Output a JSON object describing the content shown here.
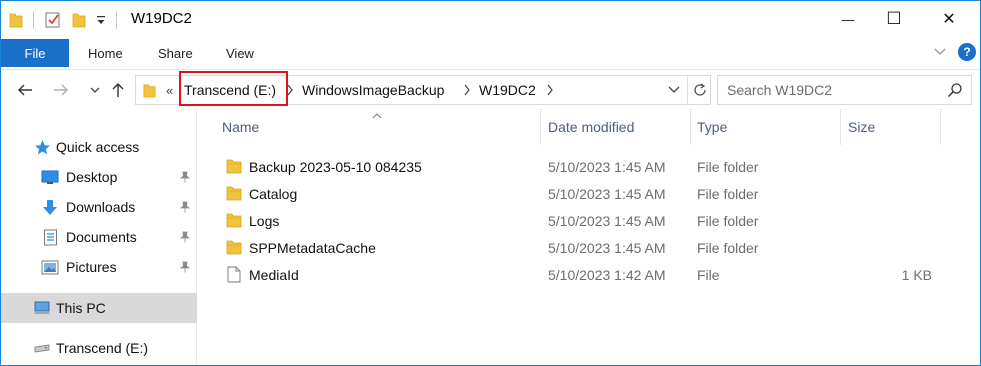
{
  "window": {
    "title": "W19DC2",
    "minimize_glyph": "—",
    "maximize_glyph": "☐",
    "close_glyph": "✕"
  },
  "ribbon": {
    "tabs": [
      "File",
      "Home",
      "Share",
      "View"
    ],
    "help_glyph": "?",
    "accent_color": "#1a6fc9"
  },
  "address": {
    "overflow_glyph": "«",
    "crumbs": [
      "Transcend (E:)",
      "WindowsImageBackup",
      "W19DC2"
    ],
    "highlight_color": "#e0121b"
  },
  "search": {
    "placeholder": "Search W19DC2"
  },
  "sidebar": {
    "items": [
      {
        "label": "Quick access",
        "icon": "star-icon"
      },
      {
        "label": "Desktop",
        "icon": "desktop-icon",
        "pinned": true
      },
      {
        "label": "Downloads",
        "icon": "download-icon",
        "pinned": true
      },
      {
        "label": "Documents",
        "icon": "documents-icon",
        "pinned": true
      },
      {
        "label": "Pictures",
        "icon": "pictures-icon",
        "pinned": true
      },
      {
        "label": "This PC",
        "icon": "computer-icon"
      },
      {
        "label": "Transcend (E:)",
        "icon": "drive-icon"
      }
    ]
  },
  "columns": [
    "Name",
    "Date modified",
    "Type",
    "Size"
  ],
  "files": [
    {
      "name": "Backup 2023-05-10 084235",
      "date": "5/10/2023 1:45 AM",
      "type": "File folder",
      "size": "",
      "icon": "folder-icon"
    },
    {
      "name": "Catalog",
      "date": "5/10/2023 1:45 AM",
      "type": "File folder",
      "size": "",
      "icon": "folder-icon"
    },
    {
      "name": "Logs",
      "date": "5/10/2023 1:45 AM",
      "type": "File folder",
      "size": "",
      "icon": "folder-icon"
    },
    {
      "name": "SPPMetadataCache",
      "date": "5/10/2023 1:45 AM",
      "type": "File folder",
      "size": "",
      "icon": "folder-icon"
    },
    {
      "name": "MediaId",
      "date": "5/10/2023 1:42 AM",
      "type": "File",
      "size": "1 KB",
      "icon": "file-icon"
    }
  ]
}
